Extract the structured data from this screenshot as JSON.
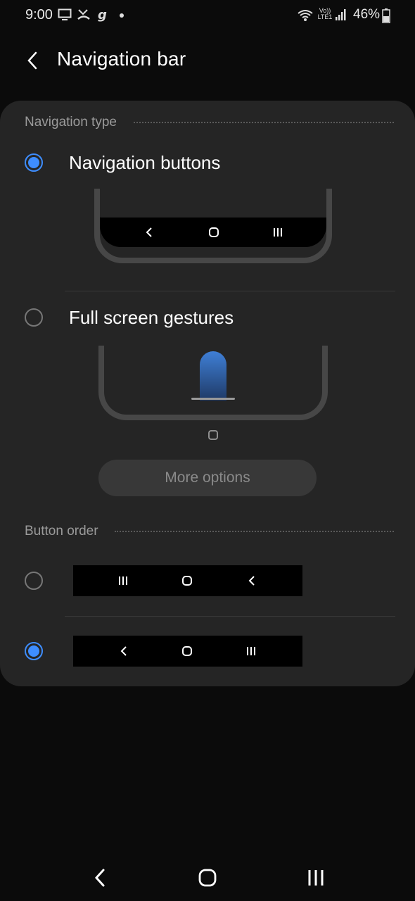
{
  "status_bar": {
    "time": "9:00",
    "battery_percent": "46%",
    "network_label_top": "Vo))",
    "network_label_bottom": "LTE1",
    "icons": [
      "monitor-icon",
      "missed-call-icon",
      "g-app-icon",
      "dot-icon",
      "wifi-icon",
      "volte-icon",
      "signal-icon",
      "battery-icon"
    ]
  },
  "header": {
    "title": "Navigation bar",
    "back_icon": "back-arrow-icon"
  },
  "navigation_type": {
    "section_label": "Navigation type",
    "options": [
      {
        "label": "Navigation buttons",
        "selected": true
      },
      {
        "label": "Full screen gestures",
        "selected": false
      }
    ],
    "more_options_label": "More options",
    "more_options_enabled": false
  },
  "button_order": {
    "section_label": "Button order",
    "options": [
      {
        "order": [
          "recents-icon",
          "home-icon",
          "back-icon"
        ],
        "selected": false
      },
      {
        "order": [
          "back-icon",
          "home-icon",
          "recents-icon"
        ],
        "selected": true
      }
    ]
  },
  "system_nav": {
    "buttons": [
      "back-icon",
      "home-icon",
      "recents-icon"
    ]
  },
  "colors": {
    "accent": "#3e8dff",
    "card": "#252525",
    "background": "#0b0b0b"
  }
}
